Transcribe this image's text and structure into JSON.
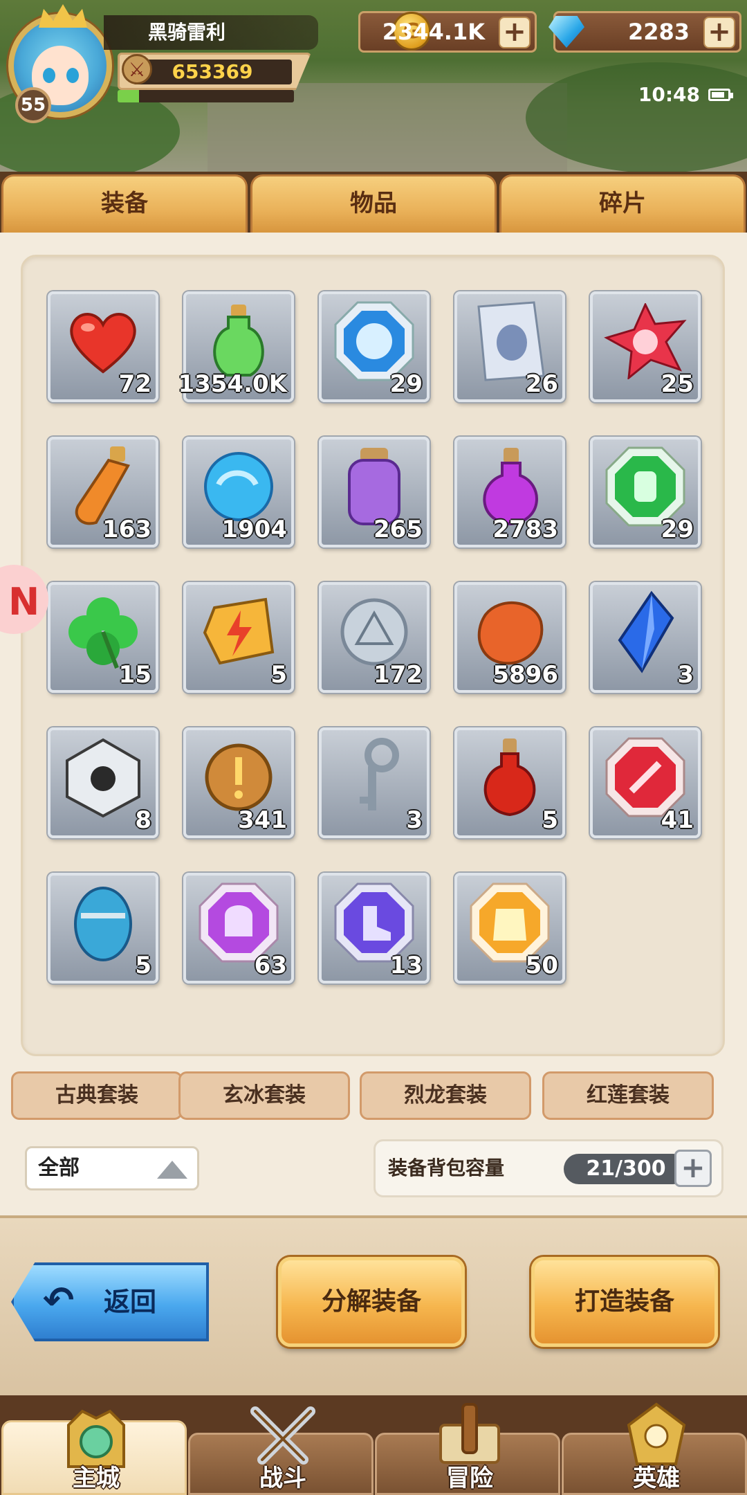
{
  "player": {
    "name": "黑骑雷利",
    "level": "55",
    "power": "653369",
    "exp_fraction": 0.12
  },
  "currency": {
    "gold": "2344.1K",
    "gems": "2283",
    "plus": "+"
  },
  "status": {
    "time": "10:48"
  },
  "tabs": [
    "装备",
    "物品",
    "碎片"
  ],
  "items": [
    {
      "icon": "heart-icon",
      "count": "72"
    },
    {
      "icon": "green-potion-icon",
      "count": "1354.0K"
    },
    {
      "icon": "blue-shield-gem-icon",
      "count": "29"
    },
    {
      "icon": "armor-scroll-icon",
      "count": "26"
    },
    {
      "icon": "red-star-crystal-icon",
      "count": "25"
    },
    {
      "icon": "orange-vial-icon",
      "count": "163"
    },
    {
      "icon": "blue-orb-icon",
      "count": "1904"
    },
    {
      "icon": "purple-jar-icon",
      "count": "265"
    },
    {
      "icon": "purple-flask-icon",
      "count": "2783"
    },
    {
      "icon": "green-glove-gem-icon",
      "count": "29"
    },
    {
      "icon": "clover-icon",
      "count": "15"
    },
    {
      "icon": "lightning-stone-icon",
      "count": "5"
    },
    {
      "icon": "silver-triforce-coin-icon",
      "count": "172"
    },
    {
      "icon": "orange-ore-icon",
      "count": "5896"
    },
    {
      "icon": "blue-crystal-icon",
      "count": "3"
    },
    {
      "icon": "skull-box-icon",
      "count": "8"
    },
    {
      "icon": "bronze-coin-icon",
      "count": "341"
    },
    {
      "icon": "key-icon",
      "count": "3"
    },
    {
      "icon": "red-potion-icon",
      "count": "5"
    },
    {
      "icon": "red-sword-gem-icon",
      "count": "41"
    },
    {
      "icon": "blue-egg-icon",
      "count": "5"
    },
    {
      "icon": "purple-helmet-gem-icon",
      "count": "63"
    },
    {
      "icon": "purple-boots-gem-icon",
      "count": "13"
    },
    {
      "icon": "gold-armor-gem-icon",
      "count": "50"
    }
  ],
  "sets": [
    "古典套装",
    "玄冰套装",
    "烈龙套装",
    "红莲套装"
  ],
  "filter": {
    "label": "全部"
  },
  "capacity": {
    "label": "装备背包容量",
    "value": "21/300"
  },
  "actions": {
    "back": "返回",
    "decompose": "分解装备",
    "forge": "打造装备"
  },
  "nav": [
    "主城",
    "战斗",
    "冒险",
    "英雄"
  ],
  "colors": {
    "tab_gold": "#eab25a",
    "slot_gray": "#8e98a6",
    "back_blue": "#4aa8ee",
    "count_white": "#ffffff"
  }
}
